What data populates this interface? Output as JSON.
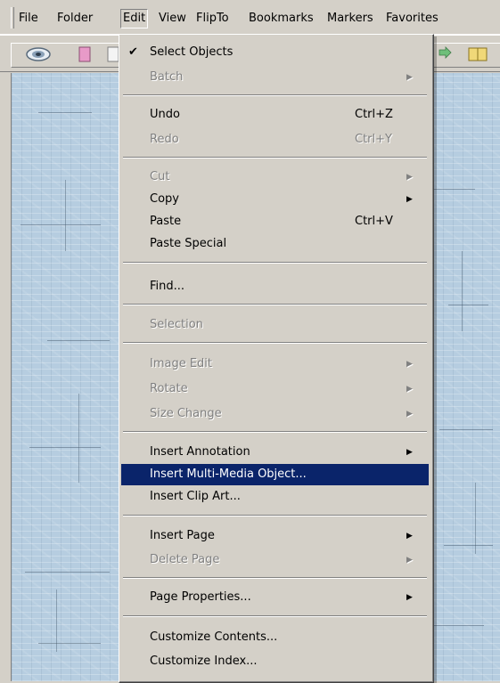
{
  "menubar": {
    "items": [
      "File",
      "Folder",
      "Edit",
      "View",
      "FlipTo",
      "Bookmarks",
      "Markers",
      "Favorites"
    ]
  },
  "edit_menu": {
    "items": [
      {
        "label": "Select Objects",
        "checked": true,
        "enabled": true
      },
      {
        "label": "Batch",
        "submenu": true,
        "enabled": false
      },
      {
        "label": "Undo",
        "shortcut": "Ctrl+Z",
        "enabled": true
      },
      {
        "label": "Redo",
        "shortcut": "Ctrl+Y",
        "enabled": false
      },
      {
        "label": "Cut",
        "submenu": true,
        "enabled": false
      },
      {
        "label": "Copy",
        "submenu": true,
        "enabled": true
      },
      {
        "label": "Paste",
        "shortcut": "Ctrl+V",
        "enabled": true
      },
      {
        "label": "Paste Special",
        "enabled": true
      },
      {
        "label": "Find...",
        "enabled": true
      },
      {
        "label": "Selection",
        "enabled": false
      },
      {
        "label": "Image Edit",
        "submenu": true,
        "enabled": false
      },
      {
        "label": "Rotate",
        "submenu": true,
        "enabled": false
      },
      {
        "label": "Size Change",
        "submenu": true,
        "enabled": false
      },
      {
        "label": "Insert Annotation",
        "submenu": true,
        "enabled": true
      },
      {
        "label": "Insert Multi-Media Object...",
        "enabled": true,
        "highlighted": true
      },
      {
        "label": "Insert Clip Art...",
        "enabled": true
      },
      {
        "label": "Insert Page",
        "submenu": true,
        "enabled": true
      },
      {
        "label": "Delete Page",
        "submenu": true,
        "enabled": false
      },
      {
        "label": "Page Properties...",
        "submenu": true,
        "enabled": true
      },
      {
        "label": "Customize Contents...",
        "enabled": true
      },
      {
        "label": "Customize Index...",
        "enabled": true
      }
    ]
  },
  "colors": {
    "menu_bg": "#d4d0c8",
    "highlight": "#0a246a",
    "workspace": "#b6cde0"
  }
}
